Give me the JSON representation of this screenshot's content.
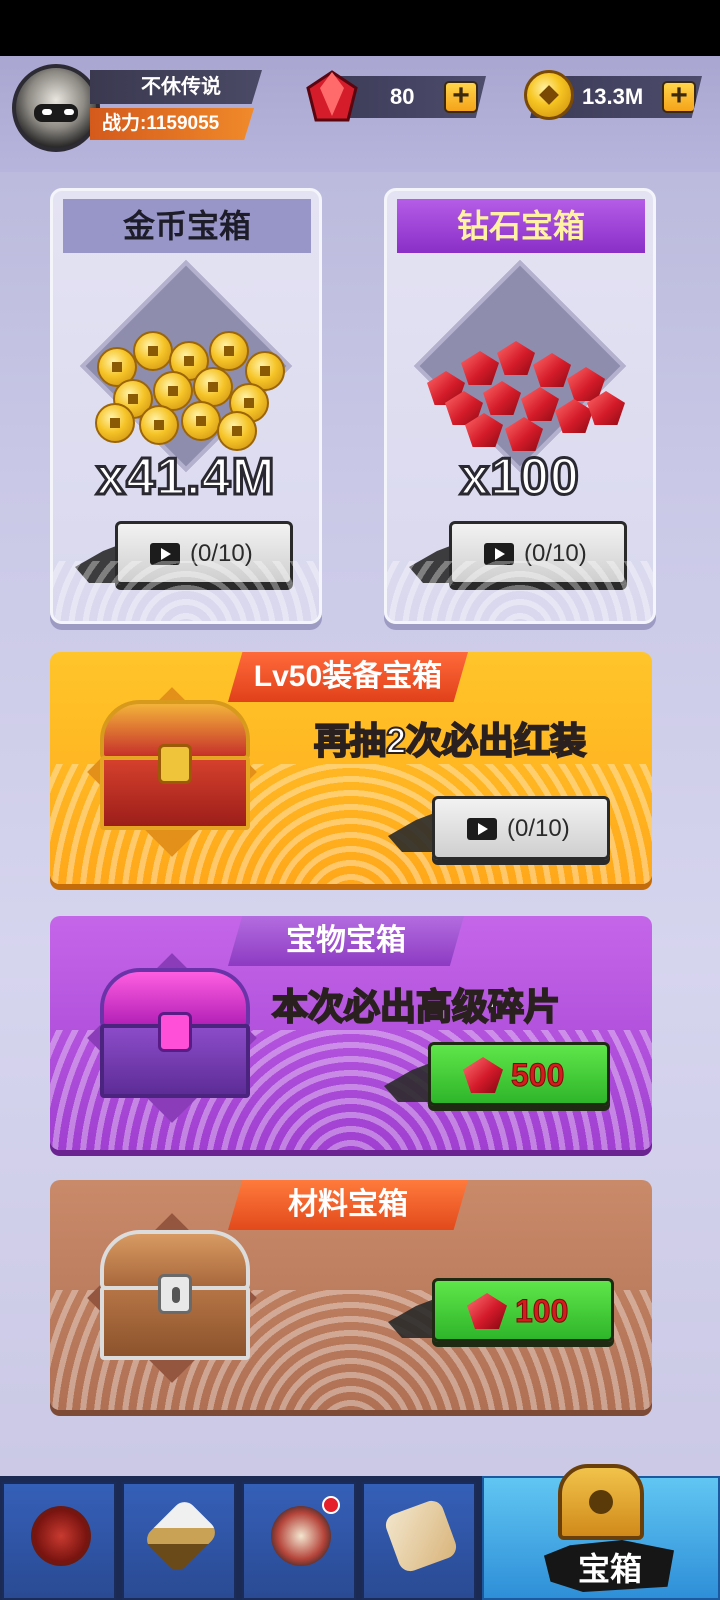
{
  "player": {
    "name": "不休传说",
    "power": "战力:1159055"
  },
  "currency": {
    "gems": "80",
    "gold": "13.3M",
    "plus_label": "+"
  },
  "cards": {
    "gold_chest": {
      "title": "金币宝箱",
      "amount": "x41.4M",
      "ad_progress": "(0/10)",
      "icon": "coin-pile-icon"
    },
    "gem_chest": {
      "title": "钻石宝箱",
      "amount": "x100",
      "ad_progress": "(0/10)",
      "icon": "gem-pile-icon"
    }
  },
  "banners": {
    "equip": {
      "tag": "Lv50装备宝箱",
      "desc": "再抽2次必出红装",
      "ad_progress": "(0/10)"
    },
    "treasure": {
      "tag": "宝物宝箱",
      "desc": "本次必出高级碎片",
      "price": "500"
    },
    "material": {
      "tag": "材料宝箱",
      "price": "100"
    }
  },
  "nav": {
    "tabs": [
      {
        "id": "hero",
        "icon": "hero-icon"
      },
      {
        "id": "weapon",
        "icon": "sword-icon"
      },
      {
        "id": "dojo",
        "icon": "drum-icon",
        "has_dot": true
      },
      {
        "id": "map",
        "icon": "scroll-icon"
      },
      {
        "id": "chest",
        "icon": "chest-icon",
        "label": "宝箱",
        "active": true
      }
    ]
  },
  "colors": {
    "gem_red": "#d51c2a",
    "gold": "#f6c529",
    "buy_green": "#2fb52a",
    "active_tab": "#61c6f2"
  }
}
